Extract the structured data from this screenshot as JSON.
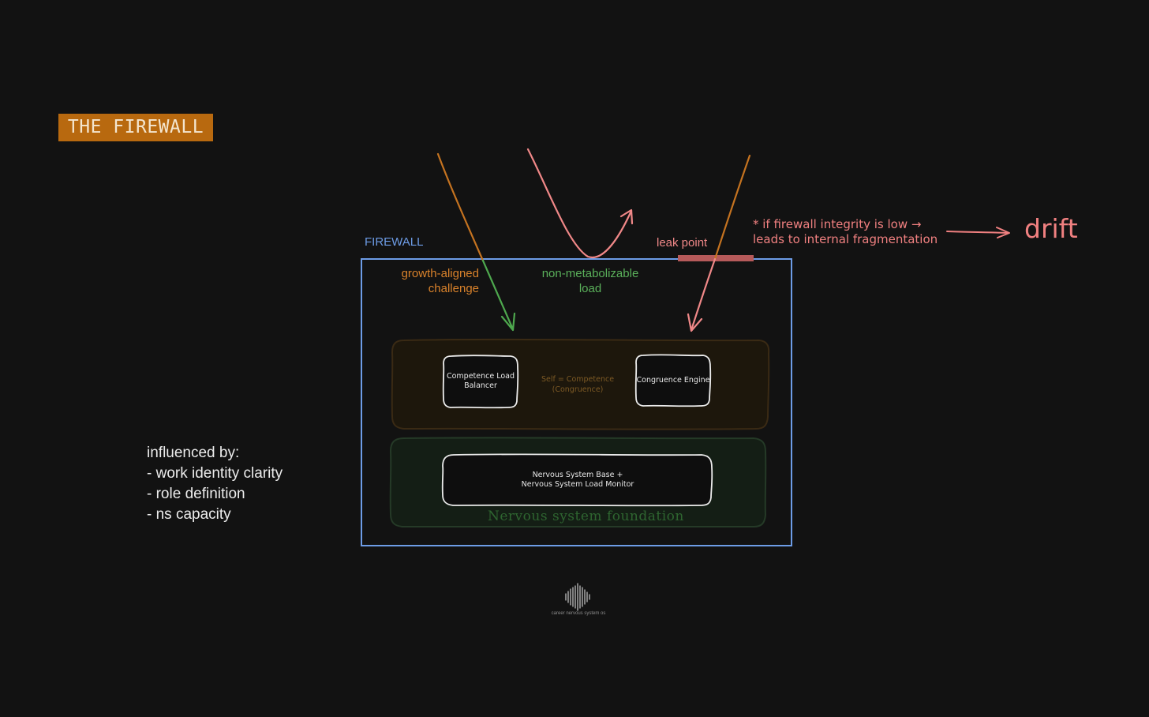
{
  "title": "THE FIREWALL",
  "firewall_label": "FIREWALL",
  "inputs": {
    "growth": "growth-aligned challenge",
    "non_metabolizable": "non-metabolizable load"
  },
  "leak_point": "leak point",
  "note": {
    "line1": "* if firewall integrity is low →",
    "line2": "leads to internal fragmentation"
  },
  "drift": "drift",
  "self_layer": {
    "left_box": "Competence Load Balancer",
    "center_text": "Self = Competence (Congruence)",
    "right_box": "Congruence Engine"
  },
  "ns_layer": {
    "box_line1": "Nervous System Base +",
    "box_line2": "Nervous System Load Monitor",
    "label": "Nervous system foundation"
  },
  "influenced": {
    "heading": "influenced by:",
    "items": [
      "- work identity clarity",
      "- role definition",
      "- ns capacity"
    ]
  },
  "footer": "career nervous system os",
  "colors": {
    "background": "#121212",
    "firewall": "#6d9ce6",
    "growth": "#d9822b",
    "green": "#5ab05a",
    "pink": "#f08888",
    "leak_bar": "#b65a5a",
    "badge": "#b8690f",
    "self_fill": "#1d170c",
    "self_stroke": "#3a2a14",
    "ns_fill": "#141e15",
    "ns_stroke": "#253a27"
  }
}
